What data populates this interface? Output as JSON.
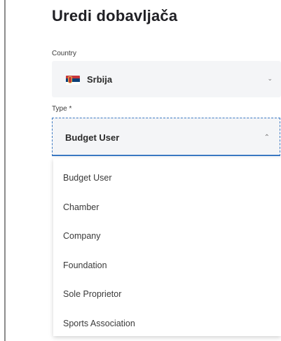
{
  "page": {
    "title": "Uredi dobavljača"
  },
  "country": {
    "label": "Country",
    "value": "Srbija",
    "flag_icon": "serbia-flag-icon",
    "flag_colors": [
      "#c6363c",
      "#0c4076",
      "#ffffff"
    ],
    "chevron_icon": "chevron-down-icon"
  },
  "type": {
    "label": "Type *",
    "value": "Budget User",
    "chevron_icon": "chevron-up-icon",
    "options": [
      "Budget User",
      "Chamber",
      "Company",
      "Foundation",
      "Sole Proprietor",
      "Sports Association"
    ]
  },
  "colors": {
    "focus_border": "#3b78c2",
    "field_bg": "#f4f5f7"
  }
}
